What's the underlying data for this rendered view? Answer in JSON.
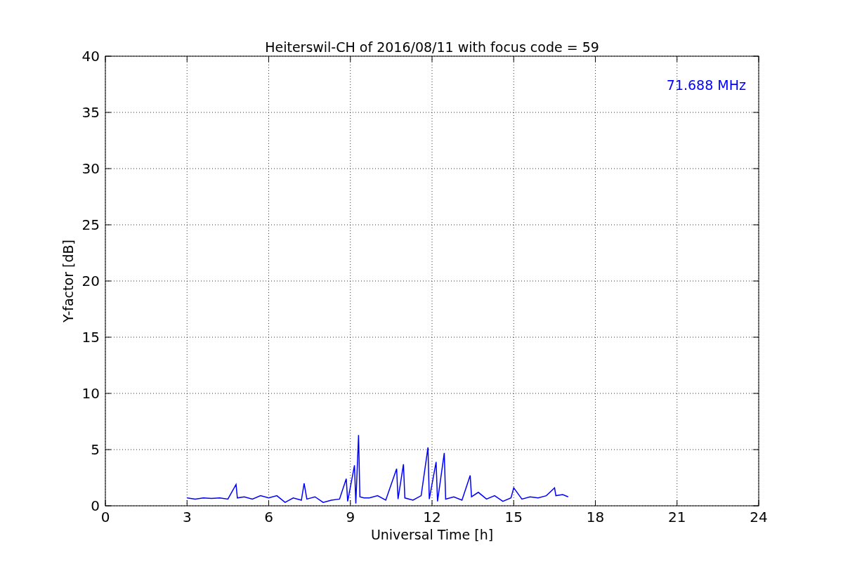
{
  "chart_data": {
    "type": "line",
    "title": "Heiterswil-CH of 2016/08/11 with focus code = 59",
    "xlabel": "Universal Time [h]",
    "ylabel": "Y-factor [dB]",
    "x": [
      3,
      3.3,
      3.6,
      3.9,
      4.2,
      4.5,
      4.8,
      4.85,
      5.1,
      5.4,
      5.7,
      6.0,
      6.3,
      6.6,
      6.9,
      7.2,
      7.3,
      7.4,
      7.7,
      8.0,
      8.3,
      8.6,
      8.85,
      8.9,
      9.15,
      9.2,
      9.3,
      9.35,
      9.5,
      9.7,
      10.0,
      10.3,
      10.7,
      10.75,
      10.95,
      11.0,
      11.3,
      11.6,
      11.85,
      11.9,
      12.15,
      12.2,
      12.45,
      12.5,
      12.8,
      13.1,
      13.4,
      13.45,
      13.7,
      14.0,
      14.3,
      14.6,
      14.9,
      15.0,
      15.3,
      15.6,
      15.9,
      16.2,
      16.5,
      16.55,
      16.8,
      17.0
    ],
    "series": [
      {
        "color": "#0000ff",
        "values": [
          0.7,
          0.6,
          0.7,
          0.65,
          0.7,
          0.6,
          1.9,
          0.7,
          0.8,
          0.6,
          0.9,
          0.7,
          0.9,
          0.3,
          0.7,
          0.5,
          2.0,
          0.6,
          0.8,
          0.3,
          0.5,
          0.6,
          2.4,
          0.4,
          3.6,
          0.2,
          6.3,
          0.8,
          0.7,
          0.7,
          0.9,
          0.5,
          3.3,
          0.6,
          3.7,
          0.7,
          0.5,
          0.9,
          5.2,
          0.6,
          3.9,
          0.4,
          4.7,
          0.6,
          0.8,
          0.5,
          2.7,
          0.8,
          1.2,
          0.6,
          0.9,
          0.4,
          0.7,
          1.6,
          0.6,
          0.8,
          0.7,
          0.9,
          1.6,
          0.9,
          1.0,
          0.8
        ]
      }
    ],
    "xlim": [
      0,
      24
    ],
    "ylim": [
      0,
      40
    ],
    "xticks": [
      0,
      3,
      6,
      9,
      12,
      15,
      18,
      21,
      24
    ],
    "yticks": [
      0,
      5,
      10,
      15,
      20,
      25,
      30,
      35,
      40
    ],
    "grid": true,
    "annotations": [
      {
        "text": "71.688 MHz"
      }
    ]
  }
}
